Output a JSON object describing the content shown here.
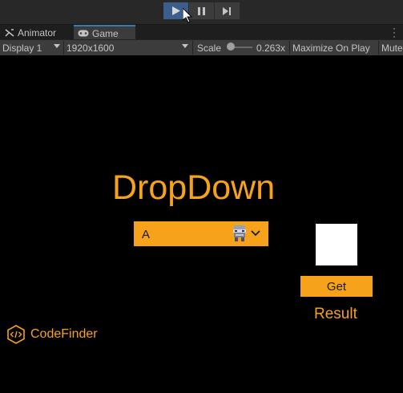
{
  "toolbar_top": {
    "play_label": "Play",
    "pause_label": "Pause",
    "step_label": "Step"
  },
  "tabs": [
    {
      "label": "Animator",
      "icon": "animator-icon"
    },
    {
      "label": "Game",
      "icon": "gamepad-icon"
    }
  ],
  "game_toolbar": {
    "display": "Display 1",
    "resolution": "1920x1600",
    "scale_label": "Scale",
    "scale_value": "0.263x",
    "maximize": "Maximize On Play",
    "mute": "Mute Audio"
  },
  "game": {
    "title": "DropDown",
    "dropdown_value": "A",
    "get_button": "Get",
    "result_text": "Result",
    "logo_text": "CodeFinder"
  },
  "colors": {
    "accent": "#f7a21b",
    "background": "#000000",
    "panel": "#3c3c3c"
  }
}
